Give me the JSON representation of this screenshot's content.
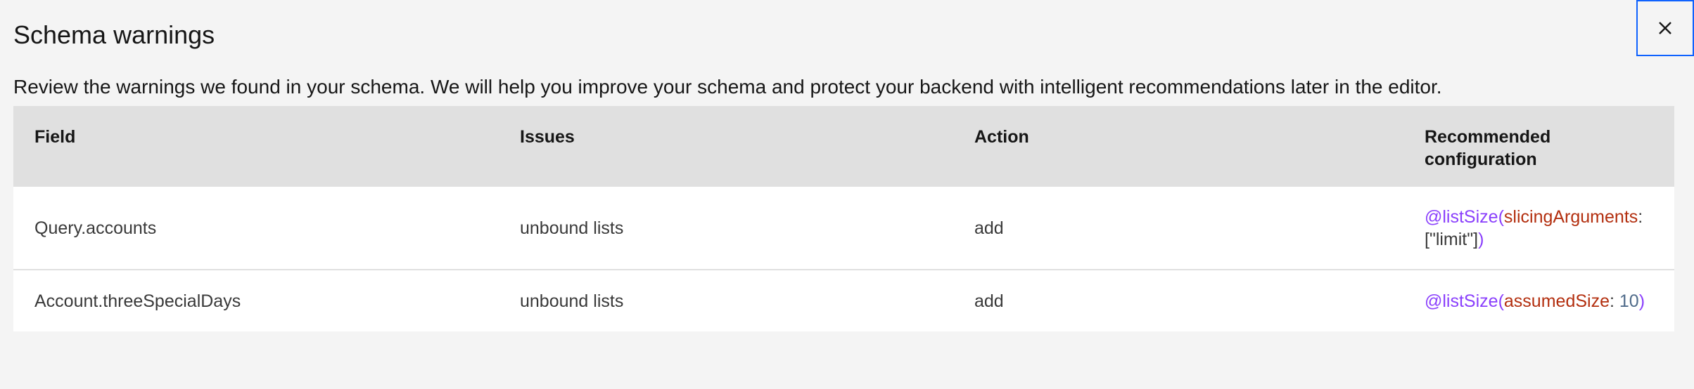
{
  "modal": {
    "title": "Schema warnings",
    "close_icon": "close-icon",
    "description": "Review the warnings we found in your schema. We will help you improve your schema and protect your backend with intelligent recommendations later in the editor."
  },
  "table": {
    "headers": {
      "field": "Field",
      "issues": "Issues",
      "action": "Action",
      "recommended_line1": "Recommended",
      "recommended_line2": "configuration"
    },
    "rows": [
      {
        "field": "Query.accounts",
        "issues": "unbound lists",
        "action": "add",
        "config": {
          "directive": "@listSize",
          "open": "(",
          "arg": "slicingArguments",
          "colon": ":",
          "value": "[\"limit\"]",
          "close": ")"
        }
      },
      {
        "field": "Account.threeSpecialDays",
        "issues": "unbound lists",
        "action": "add",
        "config": {
          "directive": "@listSize",
          "open": "(",
          "arg": "assumedSize",
          "colon": ": ",
          "value": "10",
          "close": ")"
        }
      }
    ]
  },
  "colors": {
    "directive": "#8a3ffc",
    "argument": "#b32f0f",
    "number": "#4f6b8a",
    "focus_border": "#0f62fe",
    "header_bg": "#e0e0e0",
    "page_bg": "#f4f4f4"
  }
}
